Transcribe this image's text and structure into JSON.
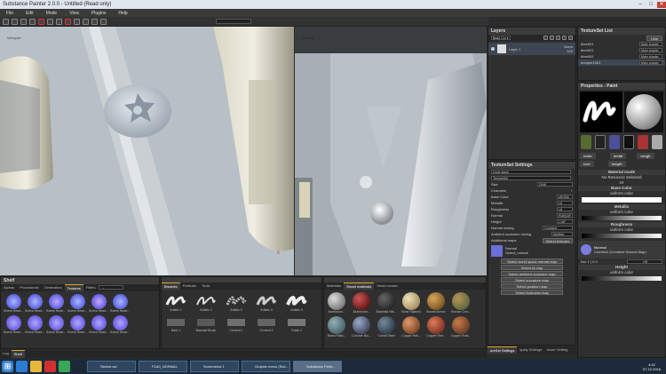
{
  "window": {
    "title": "Substance Painter 2.0.0 - Untitled (Read only)",
    "minimize": "–",
    "maximize": "□",
    "close": "✕"
  },
  "menu": [
    "File",
    "Edit",
    "Mode",
    "View",
    "Plugins",
    "Help"
  ],
  "toolbar": {
    "icons": [
      "brush-icon",
      "eraser-icon",
      "projection-icon",
      "geometry-icon",
      "polygon-fill-icon",
      "smudge-icon",
      "clone-icon",
      "picker-icon",
      "camera-icon",
      "fit-icon",
      "symmetry-icon",
      "fill-icon"
    ]
  },
  "viewport3d": {
    "label": "Viewport"
  },
  "viewport2d": {
    "label": "Material",
    "axis": "y,x"
  },
  "layers": {
    "title": "Layers",
    "blend": "Base Col ▾",
    "layer_name": "Layer 1",
    "blend_mode": "Norm",
    "opacity": "100"
  },
  "textureset_list": {
    "title": "TextureSet List",
    "button": "Hide",
    "items": [
      {
        "name": "bbrs001",
        "shader": "Main shader"
      },
      {
        "name": "bbrs001",
        "shader": "Main shader"
      },
      {
        "name": "bbrs002",
        "shader": "Main shader"
      },
      {
        "name": "bumper1001",
        "shader": "Main shader"
      }
    ]
  },
  "textureset_settings": {
    "title": "TextureSet Settings",
    "undo_stack": "Undo stack",
    "name": "TextureSet",
    "size_label": "Size",
    "size_value": "2048",
    "channels_label": "Channels",
    "channels": [
      {
        "name": "Base Color",
        "format": "sRGB8"
      },
      {
        "name": "Metallic",
        "format": "L8"
      },
      {
        "name": "Roughness",
        "format": "L8"
      },
      {
        "name": "Normal",
        "format": "RGB16F"
      },
      {
        "name": "Height",
        "format": "L16F"
      }
    ],
    "normal_mixing_label": "Normal mixing",
    "normal_mixing": "Combine",
    "ao_label": "Ambient occlusion mixing",
    "ao_value": "Multiply",
    "additional_maps": "Additional maps",
    "select_textures": "Select textures",
    "map_name": "Normal",
    "map_value": "Select_normal",
    "map_buttons": [
      "Select world space normal map",
      "Select id map",
      "Select ambient occlusion map",
      "Select curvature map",
      "Select position map",
      "Select thickness map"
    ],
    "bottom_tabs": [
      "ureSet Settings",
      "splay Settings",
      "iewer Setting"
    ]
  },
  "properties": {
    "title": "Properties - Paint",
    "tags": [
      "color",
      "metal",
      "rough",
      "nrm",
      "height"
    ],
    "material_mode": "Material mode",
    "no_resource": "No Resource Selected",
    "or": "Or",
    "base_color": "Base Color",
    "uniform_color": "uniform color",
    "metallic": "Metallic",
    "metallic_val": "uniform color",
    "roughness": "Roughness",
    "roughness_val": "uniform color",
    "normal": "Normal",
    "normal_mode": "Combine (Combine Normal Map)",
    "normal_label": "Nor 1 | 0.0",
    "normal_val": "Off",
    "height": "Height",
    "height_val": "uniform color"
  },
  "shelf": {
    "title": "Shelf",
    "tabs": [
      "Alphas",
      "Procedurals",
      "Generators",
      "Textures",
      "Filters"
    ],
    "search": "Search...",
    "items_row1": [
      "Screw Head...",
      "Screw Head...",
      "Screw Head...",
      "Screw Head...",
      "Screw Head...",
      "Screw Head..."
    ],
    "items_row2": [
      "Screw Head...",
      "Screw Head...",
      "Screw Head...",
      "Screw Head...",
      "Screw Head...",
      "Screw Head..."
    ],
    "brush_tabs": [
      "Brushes",
      "Particles",
      "Tools"
    ],
    "brushes_row1": [
      "Artistic 1",
      "Artistic 2",
      "Artistic 3",
      "Artistic 4",
      "Artistic 5"
    ],
    "brushes_row2": [
      "Bark 1",
      "Basmati Brush",
      "Cement 1",
      "Cement 2",
      "Chalk 1"
    ],
    "mat_tabs": [
      "Materials",
      "Smart materials",
      "Smart masks"
    ],
    "materials_row1": [
      "Aluminium...",
      "Aluminium...",
      "Baseball Hat...",
      "Bone Stylized",
      "Bronze Armor",
      "Bronze Corr..."
    ],
    "materials_row2": [
      "Brass Paint...",
      "Chrome Blu...",
      "Cobalt Steel",
      "Copper Hall...",
      "Copper Red...",
      "Copper Rust..."
    ],
    "bottom_tabs": [
      "Log",
      "Shelf"
    ]
  },
  "taskbar": {
    "start": "⊞",
    "windows": [
      "Sketch.wd",
      "F1A0_NORMAL",
      "Screenshot 1",
      "Graphic menu (Sub...",
      "Substance Paint..."
    ],
    "time": "4:42",
    "date": "07.12.2016"
  },
  "colors": {
    "accent": "#d8a42a",
    "titlebar": "#dfe6ef",
    "taskbar": "#1c2a3a"
  }
}
